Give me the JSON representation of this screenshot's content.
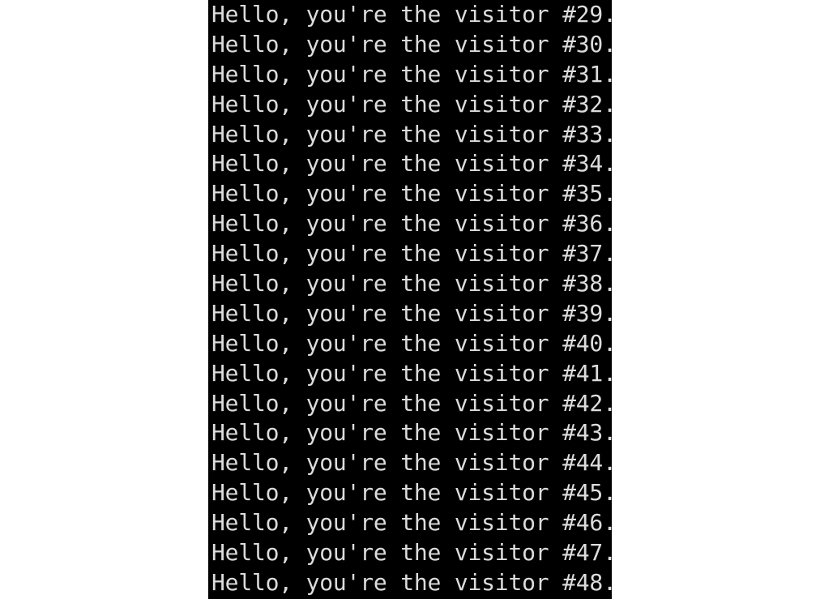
{
  "terminal": {
    "background": "#000000",
    "foreground": "#dcdcdc",
    "lines": [
      "Hello, you're the visitor #29.",
      "Hello, you're the visitor #30.",
      "Hello, you're the visitor #31.",
      "Hello, you're the visitor #32.",
      "Hello, you're the visitor #33.",
      "Hello, you're the visitor #34.",
      "Hello, you're the visitor #35.",
      "Hello, you're the visitor #36.",
      "Hello, you're the visitor #37.",
      "Hello, you're the visitor #38.",
      "Hello, you're the visitor #39.",
      "Hello, you're the visitor #40.",
      "Hello, you're the visitor #41.",
      "Hello, you're the visitor #42.",
      "Hello, you're the visitor #43.",
      "Hello, you're the visitor #44.",
      "Hello, you're the visitor #45.",
      "Hello, you're the visitor #46.",
      "Hello, you're the visitor #47.",
      "Hello, you're the visitor #48."
    ]
  }
}
